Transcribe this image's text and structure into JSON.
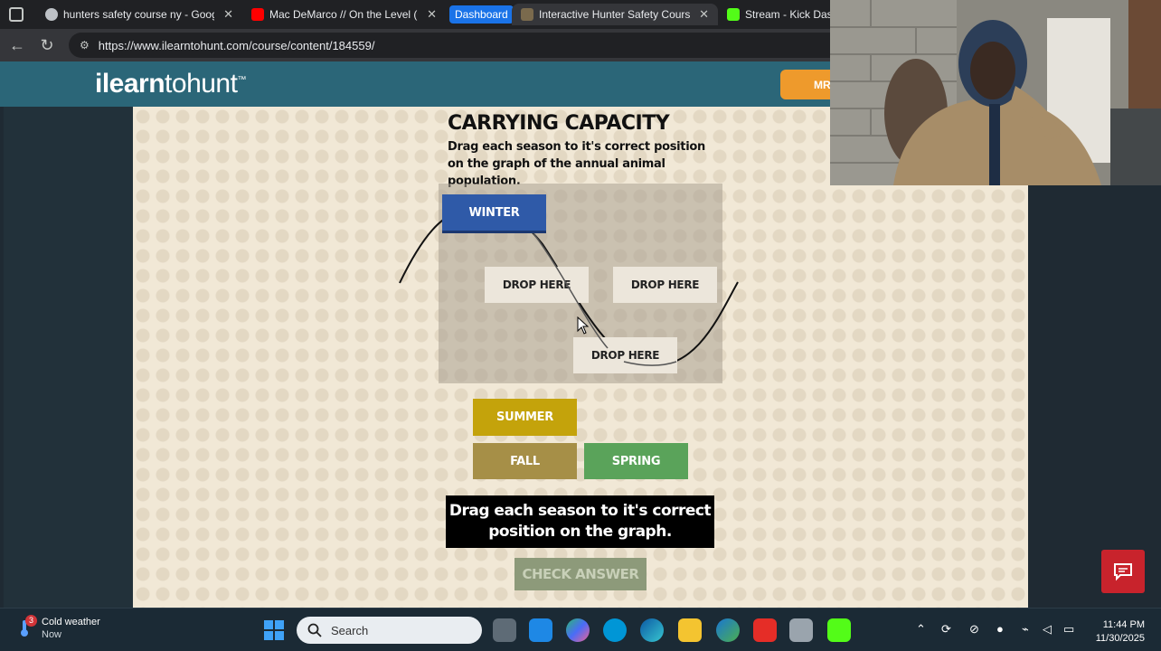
{
  "browser": {
    "tabs": [
      {
        "title": "hunters safety course ny - Google",
        "favicon_color": "#bdc1c6"
      },
      {
        "title": "Mac DeMarco // On the Level (Of",
        "favicon_color": "#ff0000"
      },
      {
        "title": "Interactive Hunter Safety Course",
        "favicon_color": "#7a6a4d"
      },
      {
        "title": "Stream - Kick Dash",
        "favicon_color": "#53fc18"
      }
    ],
    "tab_group_label": "Dashboard",
    "url": "https://www.ilearntohunt.com/course/content/184559/"
  },
  "site": {
    "logo_bold": "ilearn",
    "logo_light": "tohunt",
    "logo_tm": "™",
    "header_button": "MR"
  },
  "activity": {
    "title": "CARRYING CAPACITY",
    "instructions": "Drag each season to it's correct position on the graph of the annual animal population.",
    "placed_season": "WINTER",
    "drop_targets": [
      "DROP HERE",
      "DROP HERE",
      "DROP HERE"
    ],
    "seasons": {
      "summer": "SUMMER",
      "fall": "FALL",
      "spring": "SPRING"
    },
    "feedback": "Drag each season to it's correct position on the graph.",
    "check_button": "CHECK ANSWER"
  },
  "colors": {
    "header": "#2b6678",
    "winter": "#2f5aa8",
    "summer": "#c4a30b",
    "fall": "#a68f47",
    "spring": "#5aa35a",
    "chat": "#c8232c"
  },
  "taskbar": {
    "weather_title": "Cold weather",
    "weather_sub": "Now",
    "notification_count": "3",
    "search_placeholder": "Search",
    "time": "11:44 PM",
    "date": "11/30/2025"
  }
}
